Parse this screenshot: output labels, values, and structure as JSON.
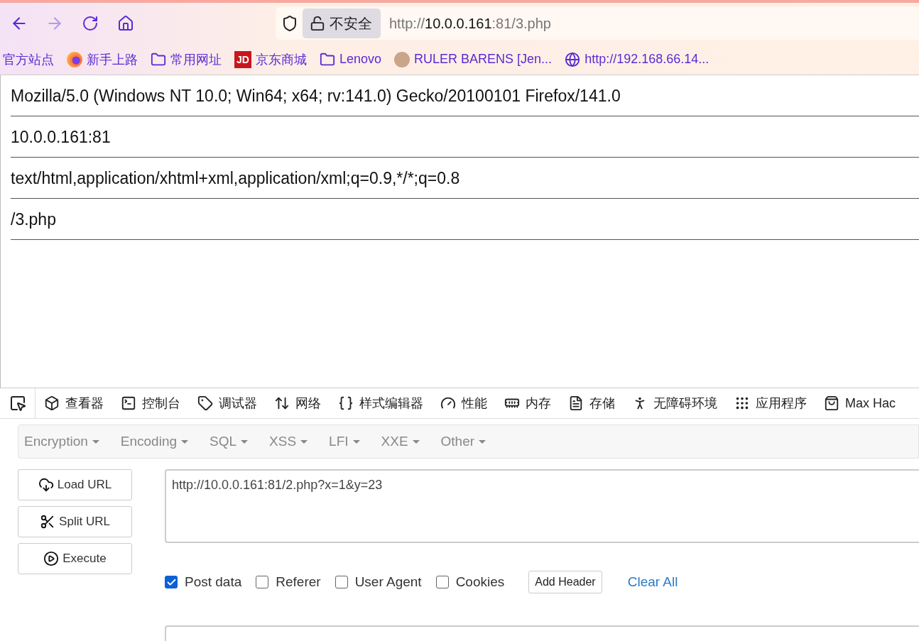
{
  "toolbar": {
    "security_label": "不安全",
    "url": {
      "scheme": "http://",
      "host": "10.0.0.161",
      "rest": ":81/3.php"
    }
  },
  "bookmarks": [
    {
      "kind": "plain",
      "label": "官方站点"
    },
    {
      "kind": "firefox",
      "label": "新手上路"
    },
    {
      "kind": "folder",
      "label": "常用网址"
    },
    {
      "kind": "logo",
      "logo_text": "JD",
      "label": "京东商城"
    },
    {
      "kind": "folder",
      "label": "Lenovo"
    },
    {
      "kind": "avatar",
      "label": "RULER BARENS [Jen..."
    },
    {
      "kind": "globe",
      "label": "http://192.168.66.14..."
    }
  ],
  "page_lines": [
    "Mozilla/5.0 (Windows NT 10.0; Win64; x64; rv:141.0) Gecko/20100101 Firefox/141.0",
    "10.0.0.161:81",
    "text/html,application/xhtml+xml,application/xml;q=0.9,*/*;q=0.8",
    "/3.php"
  ],
  "devtools_tabs": [
    {
      "label": "查看器",
      "selected": false
    },
    {
      "label": "控制台",
      "selected": false
    },
    {
      "label": "调试器",
      "selected": false
    },
    {
      "label": "网络",
      "selected": false
    },
    {
      "label": "样式编辑器",
      "selected": false
    },
    {
      "label": "性能",
      "selected": false
    },
    {
      "label": "内存",
      "selected": false
    },
    {
      "label": "存储",
      "selected": false
    },
    {
      "label": "无障碍环境",
      "selected": false
    },
    {
      "label": "应用程序",
      "selected": false
    },
    {
      "label": "Max Hac",
      "selected": false
    }
  ],
  "hackbar": {
    "menus": [
      "Encryption",
      "Encoding",
      "SQL",
      "XSS",
      "LFI",
      "XXE",
      "Other"
    ],
    "buttons": [
      "Load URL",
      "Split URL",
      "Execute"
    ],
    "url_value": "http://10.0.0.161:81/2.php?x=1&y=23",
    "options": [
      {
        "label": "Post data",
        "checked": true
      },
      {
        "label": "Referer",
        "checked": false
      },
      {
        "label": "User Agent",
        "checked": false
      },
      {
        "label": "Cookies",
        "checked": false
      }
    ],
    "add_header": "Add Header",
    "clear_all": "Clear All"
  }
}
